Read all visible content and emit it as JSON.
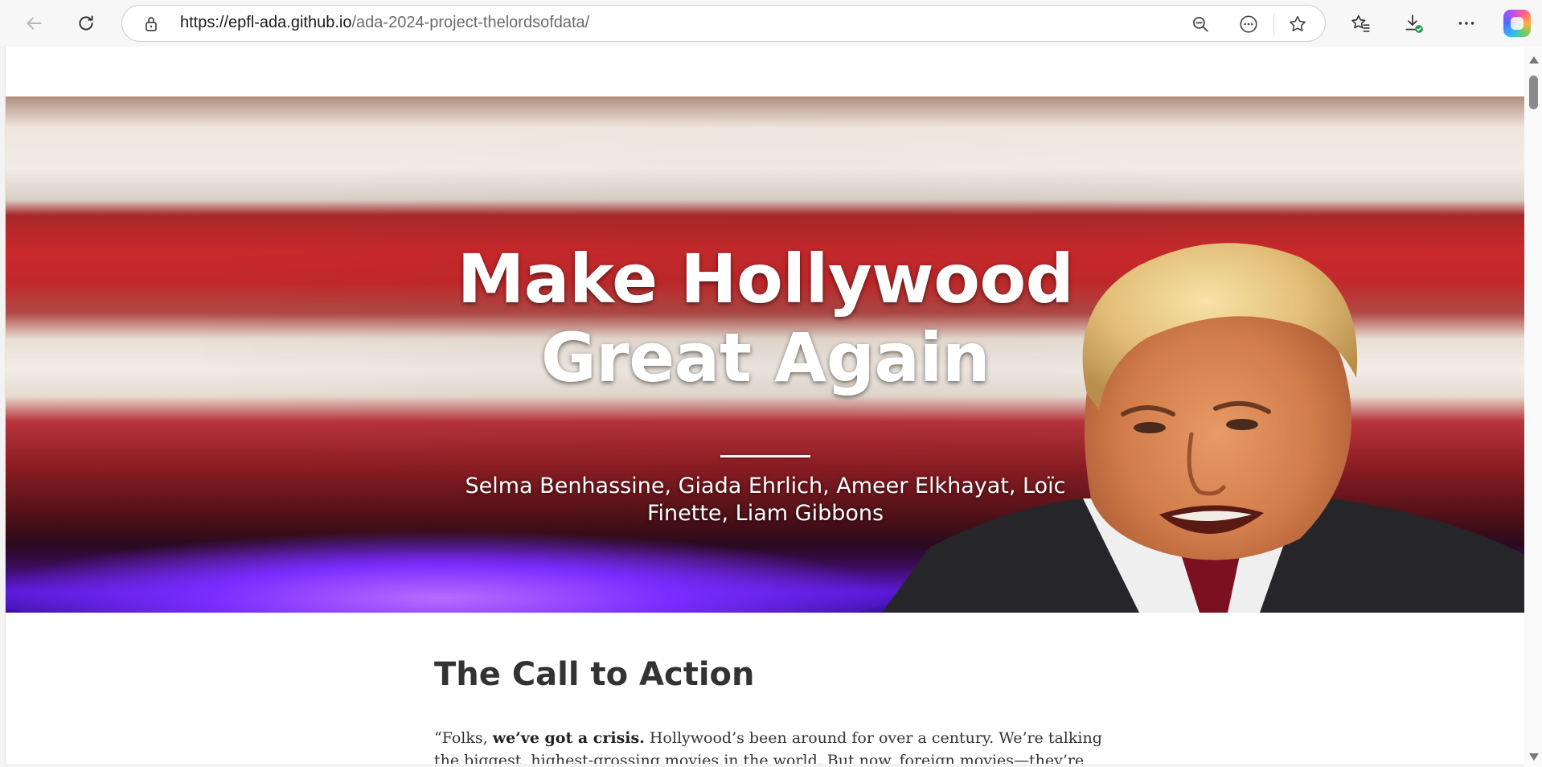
{
  "browser": {
    "url_host": "https://epfl-ada.github.io",
    "url_path": "/ada-2024-project-thelordsofdata/",
    "icons": [
      "back-arrow-icon",
      "refresh-icon",
      "lock-icon",
      "zoom-out-icon",
      "more-page-icon",
      "favorite-star-icon",
      "favorites-icon",
      "downloads-icon",
      "more-icon",
      "copilot-icon"
    ]
  },
  "hero": {
    "title_line1": "Make Hollywood",
    "title_line2": "Great Again",
    "authors": "Selma Benhassine, Giada Ehrlich, Ameer Elkhayat, Loïc Finette, Liam Gibbons"
  },
  "article": {
    "heading": "The Call to Action",
    "p1_open": "“Folks, ",
    "p1_bold": "we’ve got a crisis.",
    "p1_rest": " Hollywood’s been around for over a century. We’re talking the biggest, highest-grossing movies in the world. But now, foreign movies—they’re coming"
  },
  "colors": {
    "text": "#333333",
    "hero_text": "#ffffff",
    "stripe_red": "#c9292b"
  }
}
